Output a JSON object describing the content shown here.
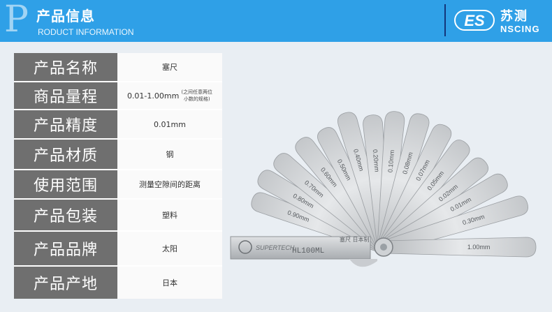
{
  "header": {
    "letter": "P",
    "title": "产品信息",
    "subtitle": "RODUCT INFORMATION",
    "bg_color": "#2fa0e7"
  },
  "brand": {
    "logo_text": "ES",
    "name_cn": "苏测",
    "name_en": "NSCING"
  },
  "specs": [
    {
      "label": "产品名称",
      "value": "塞尺"
    },
    {
      "label": "商品量程",
      "value": "0.01-1.00mm",
      "note_line1": "(之间任意两位",
      "note_line2": "小数的规格)"
    },
    {
      "label": "产品精度",
      "value": "0.01mm"
    },
    {
      "label": "产品材质",
      "value": "钢"
    },
    {
      "label": "使用范围",
      "value": "测量空隙间的距离"
    },
    {
      "label": "产品包装",
      "value": "塑料"
    },
    {
      "label": "产品品牌",
      "value": "太阳"
    },
    {
      "label": "产品产地",
      "value": "日本"
    }
  ],
  "gauge": {
    "blade_labels": [
      "0.90mm",
      "0.80mm",
      "0.70mm",
      "0.60mm",
      "0.50mm",
      "0.40mm",
      "0.20mm",
      "0.10mm",
      "0.08mm",
      "0.07mm",
      "0.05mm",
      "0.02mm",
      "0.01mm",
      "0.30mm",
      "1.00mm"
    ],
    "handle_brand": "SUPERTECH",
    "handle_model": "HL100ML",
    "handle_text_cn": "塞尺 日本制"
  }
}
